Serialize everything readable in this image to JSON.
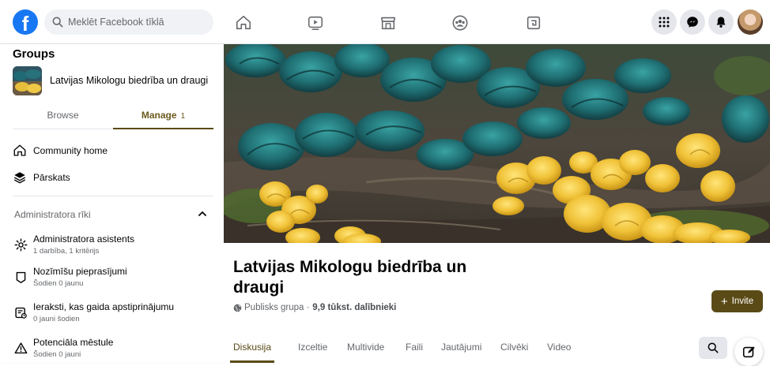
{
  "topbar": {
    "logo_letter": "f",
    "search_placeholder": "Meklēt Facebook tīklā",
    "nav_icons": [
      "home-icon",
      "video-icon",
      "marketplace-icon",
      "groups-icon",
      "gaming-icon"
    ],
    "right_icons": [
      "menu-grid-icon",
      "messenger-icon",
      "bell-icon"
    ]
  },
  "sidebar": {
    "title": "Groups",
    "group_name": "Latvijas Mikologu biedrība un draugi",
    "tabs": [
      {
        "label": "Browse"
      },
      {
        "label": "Manage",
        "count": "1"
      }
    ],
    "items": [
      {
        "label": "Community home",
        "icon": "home-icon"
      },
      {
        "label": "Pārskats",
        "icon": "overview-icon"
      }
    ],
    "admin_section": "Administratora rīki",
    "admin_tools": [
      {
        "title": "Administratora asistents",
        "sub": "1 darbība, 1 kritērijs",
        "icon": "assistant-gear-icon"
      },
      {
        "title": "Nozīmīšu pieprasījumi",
        "sub": "Šodien 0 jaunu",
        "icon": "badge-icon"
      },
      {
        "title": "Ieraksti, kas gaida apstiprinājumu",
        "sub": "0 jauni šodien",
        "icon": "pending-posts-icon"
      },
      {
        "title": "Potenciāla mēstule",
        "sub": "Šodien 0 jauni",
        "icon": "warning-icon"
      }
    ]
  },
  "group": {
    "title": "Latvijas Mikologu biedrība un draugi",
    "privacy": "Publisks grupa",
    "separator": "·",
    "members": "9,9 tūkst. dalībnieki",
    "invite_plus": "+",
    "invite_label": "Invite",
    "tabs": [
      "Diskusija",
      "Izceltie",
      "Multivide",
      "Faili",
      "Jautājumi",
      "Cilvēki",
      "Video"
    ],
    "active_tab": "Diskusija"
  },
  "colors": {
    "accent": "#5a4a16",
    "facebook_blue": "#1877f2",
    "muted_text": "#65676b"
  }
}
